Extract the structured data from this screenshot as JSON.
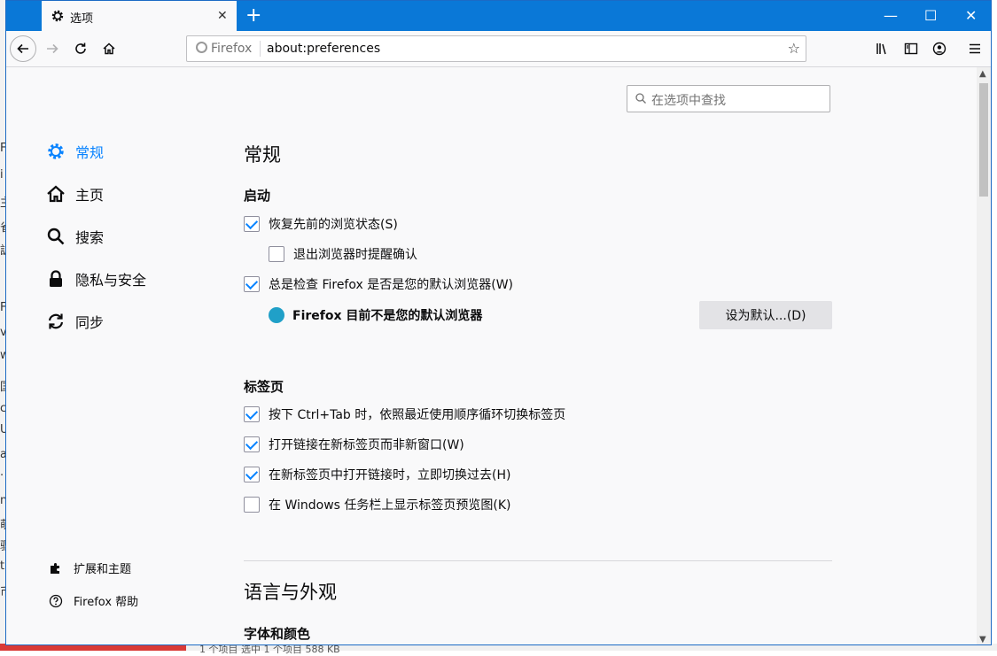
{
  "tab": {
    "title": "选项",
    "icon": "gear-icon"
  },
  "window_controls": {
    "minimize": "—",
    "maximize": "☐",
    "close": "✕"
  },
  "urlbar": {
    "identity": "Firefox",
    "url": "about:preferences"
  },
  "search": {
    "placeholder": "在选项中查找"
  },
  "categories": [
    {
      "label": "常规",
      "icon": "gear-icon",
      "active": true
    },
    {
      "label": "主页",
      "icon": "home-icon"
    },
    {
      "label": "搜索",
      "icon": "search-icon"
    },
    {
      "label": "隐私与安全",
      "icon": "lock-icon"
    },
    {
      "label": "同步",
      "icon": "sync-icon"
    }
  ],
  "sidebar_footer": [
    {
      "label": "扩展和主题",
      "icon": "puzzle-icon"
    },
    {
      "label": "Firefox 帮助",
      "icon": "help-icon"
    }
  ],
  "general": {
    "title": "常规",
    "startup": {
      "heading": "启动",
      "restore_session": {
        "label": "恢复先前的浏览状态(S)",
        "checked": true
      },
      "warn_on_quit": {
        "label": "退出浏览器时提醒确认",
        "checked": false
      },
      "check_default": {
        "label": "总是检查 Firefox 是否是您的默认浏览器(W)",
        "checked": true
      },
      "not_default_notice": "Firefox 目前不是您的默认浏览器",
      "set_default_button": "设为默认...(D)"
    },
    "tabs": {
      "heading": "标签页",
      "ctrl_tab": {
        "label": "按下 Ctrl+Tab 时，依照最近使用顺序循环切换标签页",
        "checked": true
      },
      "open_links_in_tabs": {
        "label": "打开链接在新标签页而非新窗口(W)",
        "checked": true
      },
      "switch_to_new_tabs": {
        "label": "在新标签页中打开链接时，立即切换过去(H)",
        "checked": true
      },
      "taskbar_previews": {
        "label": "在 Windows 任务栏上显示标签页预览图(K)",
        "checked": false
      }
    },
    "language_appearance": {
      "title": "语言与外观",
      "fonts_heading": "字体和颜色"
    }
  },
  "background": {
    "statusbar_text": "1 个项目    选中 1 个项目  588 KB",
    "edge_chars": [
      "F",
      "i",
      "主",
      "雀",
      "訴",
      "F",
      "v",
      "w",
      "国",
      "c",
      "U",
      "a",
      "·",
      "n",
      "萌",
      "骤",
      "t",
      "币"
    ]
  },
  "colors": {
    "titlebar": "#0a78d7",
    "accent": "#0a84ff",
    "background": "#f9f9fa"
  }
}
